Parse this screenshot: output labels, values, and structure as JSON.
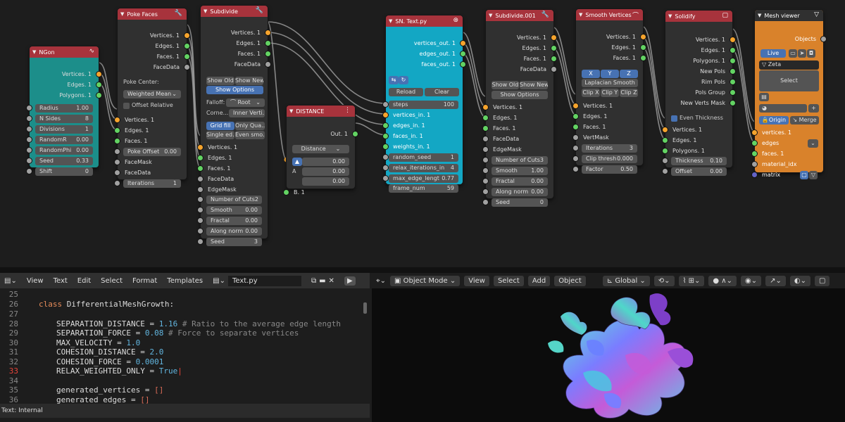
{
  "nodes": {
    "ngon": {
      "title": "NGon",
      "outputs": [
        "Vertices. 1",
        "Edges. 1",
        "Polygons. 1"
      ],
      "fields": [
        [
          "Radius",
          "1.00"
        ],
        [
          "N Sides",
          "8"
        ],
        [
          "Divisions",
          "1"
        ],
        [
          "RandomR",
          "0.00"
        ],
        [
          "RandomPhi",
          "0.00"
        ],
        [
          "Seed",
          "0.33"
        ],
        [
          "Shift",
          "0"
        ]
      ]
    },
    "poke": {
      "title": "Poke Faces",
      "outputs": [
        "Vertices. 1",
        "Edges. 1",
        "Faces. 1",
        "FaceData"
      ],
      "poke_center_label": "Poke Center:",
      "poke_center_value": "Weighted Mean",
      "offset_relative": "Offset Relative",
      "inputs": [
        "Vertices. 1",
        "Edges. 1",
        "Faces. 1"
      ],
      "poke_offset_label": "Poke Offset",
      "poke_offset_value": "0.00",
      "inputs2": [
        "FaceMask",
        "FaceData"
      ],
      "iterations_label": "Iterations",
      "iterations_value": "1"
    },
    "subdivide": {
      "title": "Subdivide",
      "outputs": [
        "Vertices. 1",
        "Edges. 1",
        "Faces. 1",
        "FaceData"
      ],
      "show_old": "Show Old",
      "show_new": "Show New",
      "show_options": "Show Options",
      "falloff_label": "Falloff:",
      "falloff_value": "Root",
      "corner_label": "Corne...",
      "corner_value": "Inner Verti...",
      "grid_fill": "Grid fill",
      "only_quads": "Only Qua...",
      "single_edge": "Single ed...",
      "even_smooth": "Even smo...",
      "inputs": [
        "Vertices. 1",
        "Edges. 1",
        "Faces. 1",
        "FaceData",
        "EdgeMask"
      ],
      "fields": [
        [
          "Number of Cuts",
          "2"
        ],
        [
          "Smooth",
          "0.00"
        ],
        [
          "Fractal",
          "0.00"
        ],
        [
          "Along norm",
          "0.00"
        ],
        [
          "Seed",
          "3"
        ]
      ]
    },
    "distance": {
      "title": "DISTANCE",
      "output": "Out. 1",
      "mode": "Distance",
      "values": [
        "0.00",
        "0.00",
        "0.00"
      ],
      "a_label": "A",
      "b_label": "B. 1"
    },
    "sn_text": {
      "title": "SN. Text.py",
      "outputs": [
        "vertices_out. 1",
        "edges_out. 1",
        "faces_out. 1"
      ],
      "reload": "Reload",
      "clear": "Clear",
      "steps_label": "steps",
      "steps_value": "100",
      "inputs": [
        "vertices_in. 1",
        "edges_in. 1",
        "faces_in. 1",
        "weights_in. 1"
      ],
      "fields": [
        [
          "random_seed",
          "1"
        ],
        [
          "relax_iterations_in",
          "4"
        ],
        [
          "max_edge_lengt",
          "0.77"
        ],
        [
          "frame_num",
          "59"
        ]
      ]
    },
    "subdivide001": {
      "title": "Subdivide.001",
      "outputs": [
        "Vertices. 1",
        "Edges. 1",
        "Faces. 1",
        "FaceData"
      ],
      "show_old": "Show Old",
      "show_new": "Show New",
      "show_options": "Show Options",
      "inputs": [
        "Vertices. 1",
        "Edges. 1",
        "Faces. 1",
        "FaceData",
        "EdgeMask"
      ],
      "fields": [
        [
          "Number of Cuts",
          "3"
        ],
        [
          "Smooth",
          "1.00"
        ],
        [
          "Fractal",
          "0.00"
        ],
        [
          "Along norm",
          "0.00"
        ],
        [
          "Seed",
          "0"
        ]
      ]
    },
    "smooth": {
      "title": "Smooth Vertices",
      "outputs": [
        "Vertices. 1",
        "Edges. 1",
        "Faces. 1"
      ],
      "x": "X",
      "y": "Y",
      "z": "Z",
      "laplacian": "Laplacian Smooth",
      "clip_x": "Clip X",
      "clip_y": "Clip Y",
      "clip_z": "Clip Z",
      "inputs": [
        "Vertices. 1",
        "Edges. 1",
        "Faces. 1",
        "VertMask"
      ],
      "fields": [
        [
          "Iterations",
          "3"
        ],
        [
          "Clip thresh",
          "0.000"
        ],
        [
          "Factor",
          "0.50"
        ]
      ]
    },
    "solidify": {
      "title": "Solidify",
      "outputs": [
        "Vertices. 1",
        "Edges. 1",
        "Polygons. 1",
        "New Pols",
        "Rim Pols",
        "Pols Group",
        "New Verts Mask"
      ],
      "even_thickness": "Even Thickness",
      "inputs": [
        "Vertices. 1",
        "Edges. 1",
        "Polygons. 1"
      ],
      "fields": [
        [
          "Thickness",
          "0.10"
        ],
        [
          "Offset",
          "0.00"
        ]
      ]
    },
    "mesh_viewer": {
      "title": "Mesh viewer",
      "objects_label": "Objects",
      "live": "Live",
      "name": "Zeta",
      "select": "Select",
      "origin": "Origin",
      "merge": "Merge",
      "inputs": [
        "vertices. 1",
        "edges",
        "faces. 1",
        "material_idx",
        "matrix"
      ]
    }
  },
  "text_editor": {
    "menu": [
      "View",
      "Text",
      "Edit",
      "Select",
      "Format",
      "Templates"
    ],
    "filename": "Text.py",
    "line_numbers": [
      "25",
      "26",
      "27",
      "28",
      "29",
      "30",
      "31",
      "32",
      "33",
      "34",
      "35",
      "36"
    ],
    "current_line": "33",
    "status": "Text: Internal"
  },
  "viewport": {
    "mode": "Object Mode",
    "menu": [
      "View",
      "Select",
      "Add",
      "Object"
    ],
    "transform": "Global"
  },
  "colors": {
    "header_red": "#a7333c",
    "header_teal": "#1c8e8a",
    "header_cyan": "#13a7c4",
    "mesh_viewer_orange": "#d9822b"
  }
}
